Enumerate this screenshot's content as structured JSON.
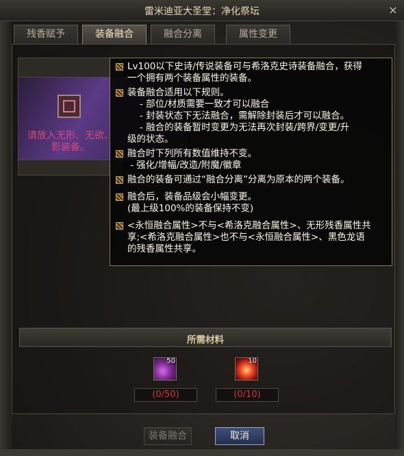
{
  "window": {
    "title": "雷米迪亚大圣堂：净化祭坛",
    "close_glyph": "×"
  },
  "tabs": [
    {
      "label": "残香赋予",
      "active": false
    },
    {
      "label": "装备融合",
      "active": true
    },
    {
      "label": "融合分离",
      "active": false
    },
    {
      "label": "属性变更",
      "active": false
    }
  ],
  "slot": {
    "hint_lines": [
      "请放入无形、无欲、",
      "影装备。"
    ]
  },
  "tooltip": {
    "items": [
      [
        "Lv100以下史诗/传说装备可与希洛克史诗装备融合，获得",
        "一个拥有两个装备属性的装备。"
      ],
      [
        "装备融合适用以下规则。",
        "- 部位/材质需要一致才可以融合",
        "- 封装状态下无法融合，需解除封装后才可以融合。",
        "- 融合的装备暂时变更为无法再次封装/跨界/变更/升",
        "级的状态。"
      ],
      [
        "融合时下列所有数值维持不变。",
        "- 强化/增幅/改造/附魔/徽章"
      ],
      [
        "融合的装备可通过“融合分离”分离为原本的两个装备。"
      ],
      [
        "融合后，装备品级会小幅变更。",
        "(最上级100%的装备保持不变)"
      ],
      [
        "<永恒融合属性>不与<希洛克融合属性>、无形残香属性共",
        "享;<希洛克融合属性>也不与<永恒融合属性>、黑色龙语",
        "的残香属性共享。"
      ]
    ]
  },
  "materials": {
    "section_title": "所需材料",
    "items": [
      {
        "icon": "purple-crystal-icon",
        "badge": "50",
        "count_text": "(0/50)",
        "count_color": "#d23a3a"
      },
      {
        "icon": "fire-orb-icon",
        "badge": "10",
        "count_text": "(0/10)",
        "count_color": "#d23a3a"
      }
    ]
  },
  "buttons": {
    "fuse_label": "装备融合",
    "cancel_label": "取消"
  }
}
